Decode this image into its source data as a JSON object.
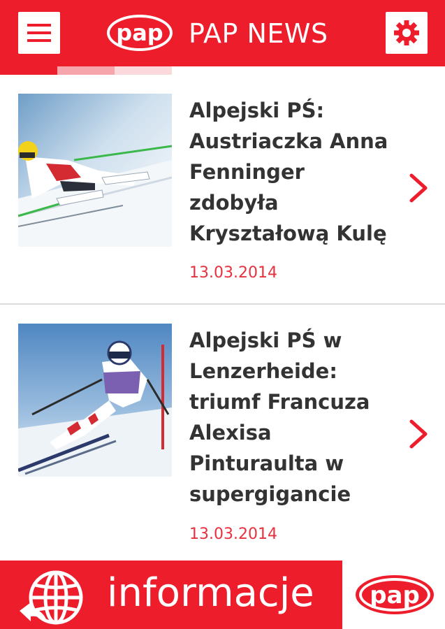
{
  "header": {
    "title": "PAP NEWS",
    "logo_text": "pap",
    "menu_icon": "hamburger-menu-icon",
    "settings_icon": "gear-icon"
  },
  "tabs": {
    "count_visible": 3
  },
  "news": [
    {
      "headline": "Alpejski PŚ: Austriaczka Anna Fenninger zdobyła Kryształową Kulę",
      "date": "13.03.2014",
      "image": "skier-photo"
    },
    {
      "headline": "Alpejski PŚ w Lenzerheide: triumf Francuza Alexisa Pinturaulta w supergigancie",
      "date": "13.03.2014",
      "image": "skier-photo"
    }
  ],
  "footer": {
    "label": "informacje",
    "logo_text": "pap",
    "globe_icon": "globe-icon"
  },
  "colors": {
    "brand_red": "#ee1d2c",
    "date_red": "#e8313f",
    "headline_text": "#333333",
    "divider": "#dcdcdc"
  }
}
